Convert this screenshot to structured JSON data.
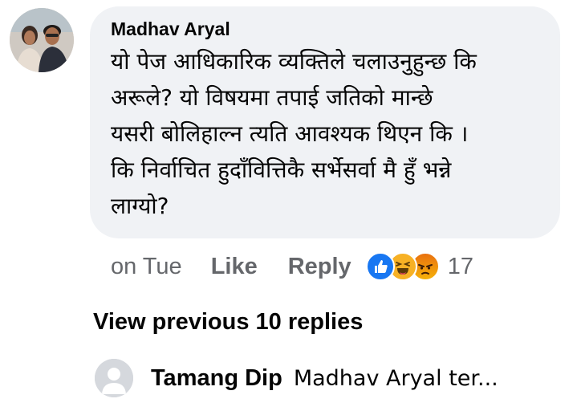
{
  "comment": {
    "author": "Madhav Aryal",
    "lines": [
      "यो पेज आधिकारिक व्यक्तिले चलाउनुहुन्छ कि",
      "अरूले? यो विषयमा तपाई जतिको मान्छे",
      "यसरी बोलिहाल्न त्यति आवश्यक थिएन कि ।",
      "कि निर्वाचित हुदाँवित्तिकै सर्भेसर्वा मै हुँ भन्ने",
      "लाग्यो?"
    ],
    "time": "on Tue",
    "like_label": "Like",
    "reply_label": "Reply",
    "reactions": [
      "like-icon",
      "haha-icon",
      "angry-icon"
    ],
    "reaction_count": "17"
  },
  "replies": {
    "view_previous_label": "View previous 10 replies",
    "latest": {
      "author": "Tamang Dip",
      "preview": "Madhav Aryal ter..."
    }
  },
  "colors": {
    "bubble_bg": "#f0f2f5",
    "secondary_text": "#65676b",
    "like_blue": "#1877f2"
  }
}
